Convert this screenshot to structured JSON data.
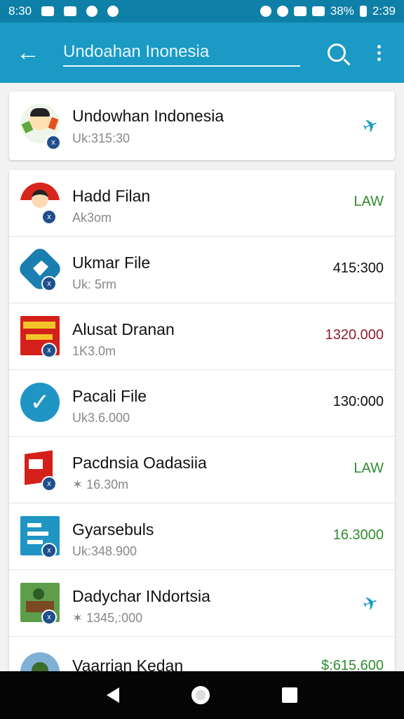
{
  "status_bar": {
    "time_left": "8:30",
    "battery": "38%",
    "time_right": "2:39"
  },
  "app_bar": {
    "search_value": "Undoahan Inonesia",
    "search_placeholder": "Search"
  },
  "pinned": {
    "title": "Undowhan Indonesia",
    "subtitle": "Uk:315:30",
    "icon": "plane-icon"
  },
  "items": [
    {
      "title": "Hadd Filan",
      "subtitle": "Ak3om",
      "value": "LAW",
      "value_color": "#2e8b2e"
    },
    {
      "title": "Ukmar File",
      "subtitle": "Uk: 5rm",
      "value": "415:300",
      "value_color": "#111111"
    },
    {
      "title": "Alusat Dranan",
      "subtitle": "1K3.0m",
      "value": "1320.000",
      "value_color": "#8b1f2a"
    },
    {
      "title": "Pacali File",
      "subtitle": "Uk3.6.000",
      "value": "130:000",
      "value_color": "#111111"
    },
    {
      "title": "Pacdnsia Oadasiia",
      "subtitle": "✶ 16.30m",
      "value": "LAW",
      "value_color": "#2e8b2e"
    },
    {
      "title": "Gyarsebuls",
      "subtitle": "Uk:348.900",
      "value": "16.3000",
      "value_color": "#2e8b2e"
    },
    {
      "title": "Dadychar INdortsia",
      "subtitle": "✶ 1345,:000",
      "value": "",
      "value_color": "#1a9ac4",
      "icon": "plane-icon"
    },
    {
      "title": "Vaarrian Kedan",
      "subtitle": "",
      "value": "$:615.600",
      "value_color": "#2e8b2e"
    }
  ]
}
